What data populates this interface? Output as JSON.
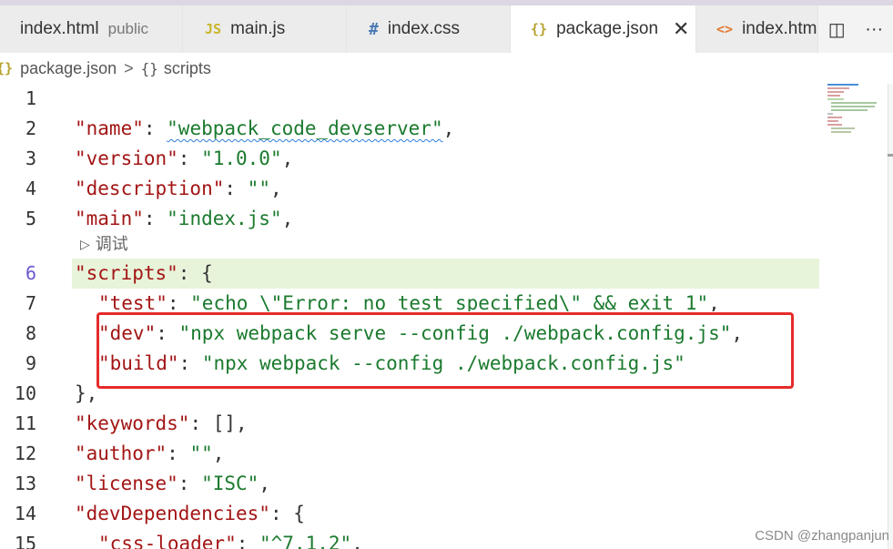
{
  "tabs": [
    {
      "label": "index.html",
      "sublabel": "public",
      "icon": "",
      "icon_color": "#e37933"
    },
    {
      "label": "main.js",
      "icon": "JS",
      "icon_color": "#c9b52c"
    },
    {
      "label": "index.css",
      "icon": "#",
      "icon_color": "#4a78b4"
    },
    {
      "label": "package.json",
      "icon": "{}",
      "icon_color": "#b8a230",
      "close": "✕"
    },
    {
      "label": "index.htm",
      "icon": "<>",
      "icon_color": "#e37933"
    }
  ],
  "tab_actions": {
    "split": "◫",
    "more": "···"
  },
  "breadcrumb": {
    "icon": "{}",
    "file": "package.json",
    "sep": ">",
    "node_icon": "{}",
    "node": "scripts"
  },
  "codelens": {
    "icon": "▷",
    "label": "调试"
  },
  "lines": [
    {
      "n": "1"
    },
    {
      "n": "2",
      "k": "\"name\"",
      "s": "\"webpack_code_devserver\"",
      "tail": ","
    },
    {
      "n": "3",
      "k": "\"version\"",
      "s": "\"1.0.0\"",
      "tail": ","
    },
    {
      "n": "4",
      "k": "\"description\"",
      "s": "\"\"",
      "tail": ","
    },
    {
      "n": "5",
      "k": "\"main\"",
      "s": "\"index.js\"",
      "tail": ","
    },
    {
      "n": "6",
      "k": "\"scripts\"",
      "tail": ": {"
    },
    {
      "n": "7",
      "k": "\"test\"",
      "s": "\"echo \\\"Error: no test specified\\\" && exit 1\"",
      "tail": ","
    },
    {
      "n": "8",
      "k": "\"dev\"",
      "s": "\"npx webpack serve --config ./webpack.config.js\"",
      "tail": ","
    },
    {
      "n": "9",
      "k": "\"build\"",
      "s": "\"npx webpack --config ./webpack.config.js\"",
      "tail": ""
    },
    {
      "n": "10",
      "tail": "},"
    },
    {
      "n": "11",
      "k": "\"keywords\"",
      "tail": ": [],"
    },
    {
      "n": "12",
      "k": "\"author\"",
      "s": "\"\"",
      "tail": ","
    },
    {
      "n": "13",
      "k": "\"license\"",
      "s": "\"ISC\"",
      "tail": ","
    },
    {
      "n": "14",
      "k": "\"devDependencies\"",
      "tail": ": {"
    },
    {
      "n": "15",
      "k": "\"css-loader\"",
      "s": "\"^7.1.2\"",
      "tail": ","
    }
  ],
  "watermark": "CSDN @zhangpanjun",
  "colors": {
    "key": "#a31515",
    "string": "#1b7a2e",
    "highlight": "#e8f4da",
    "annotation_box": "#e62b2b",
    "current_line_number": "#6a5acd"
  }
}
